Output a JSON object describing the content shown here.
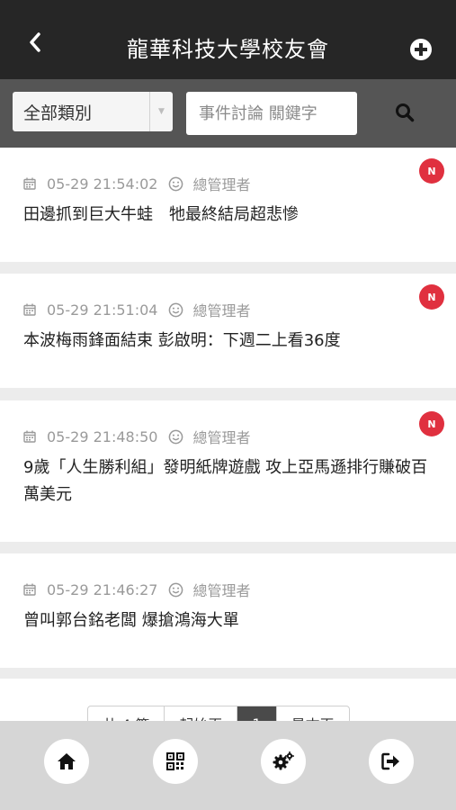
{
  "header": {
    "title": "龍華科技大學校友會",
    "back_icon": "chevron-left-icon",
    "add_icon": "plus-circle-icon"
  },
  "search": {
    "category": "全部類別",
    "placeholder": "事件討論 關鍵字",
    "search_icon": "search-icon"
  },
  "posts": [
    {
      "datetime": "05-29 21:54:02",
      "author": "總管理者",
      "title": "田邊抓到巨大牛蛙　牠最終結局超悲慘",
      "badge": "N"
    },
    {
      "datetime": "05-29 21:51:04",
      "author": "總管理者",
      "title": "本波梅雨鋒面結束 彭啟明：下週二上看36度",
      "badge": "N"
    },
    {
      "datetime": "05-29 21:48:50",
      "author": "總管理者",
      "title": "9歲「人生勝利組」發明紙牌遊戲 攻上亞馬遜排行賺破百萬美元",
      "badge": "N"
    },
    {
      "datetime": "05-29 21:46:27",
      "author": "總管理者",
      "title": "曾叫郭台銘老闆 爆搶鴻海大單",
      "badge": ""
    }
  ],
  "pager": {
    "total": "共 4 筆",
    "first": "起始頁",
    "current": "1",
    "last": "最末頁"
  },
  "tabbar": {
    "items": [
      "home-icon",
      "qrcode-icon",
      "gears-icon",
      "sign-out-icon"
    ]
  },
  "colors": {
    "header_bg": "#262626",
    "searchbar_bg": "#555555",
    "badge": "#e0303f",
    "tabbar_bg": "#d6d6d6"
  }
}
